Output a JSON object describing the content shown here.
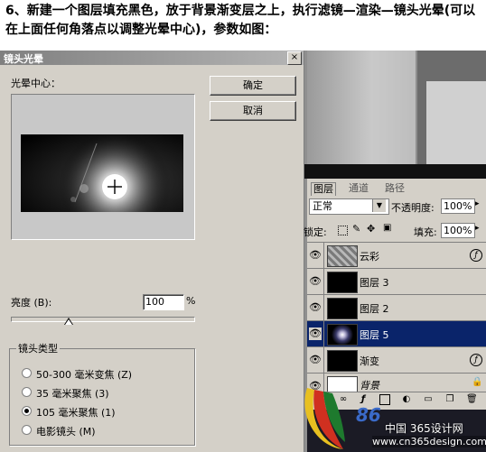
{
  "instructions": "6、新建一个图层填充黑色，放于背景渐变层之上，执行滤镜—渲染—镜头光晕(可以在上面任何角落点以调整光晕中心)，参数如图：",
  "dialog": {
    "title": "镜头光晕",
    "close": "×",
    "center_label": "光晕中心：",
    "ok": "确定",
    "cancel": "取消",
    "brightness_label": "亮度 (B):",
    "brightness_value": "100",
    "percent": "%",
    "brightness_level": 100,
    "lens_group_title": "镜头类型",
    "lens_types": [
      {
        "label": "50-300 毫米变焦 (Z)",
        "selected": false
      },
      {
        "label": "35 毫米聚焦 (3)",
        "selected": false
      },
      {
        "label": "105 毫米聚焦 (1)",
        "selected": true
      },
      {
        "label": "电影镜头 (M)",
        "selected": false
      }
    ]
  },
  "layers_panel": {
    "tabs": [
      "图层",
      "通道",
      "路径"
    ],
    "blend_mode": "正常",
    "opacity_label": "不透明度:",
    "opacity_value": "100%",
    "lock_label": "锁定:",
    "fill_label": "填充:",
    "fill_value": "100%",
    "layers": [
      {
        "name": "云彩",
        "selected": false
      },
      {
        "name": "图层 3",
        "selected": false
      },
      {
        "name": "图层 2",
        "selected": false
      },
      {
        "name": "图层 5",
        "selected": true
      },
      {
        "name": "渐变",
        "selected": false
      },
      {
        "name": "背景",
        "selected": false
      }
    ]
  },
  "watermark": {
    "site": "中国 365设计网",
    "url": "www.cn365design.com",
    "logo_text": "86"
  },
  "colors": {
    "dialog_bg": "#d4d0c8",
    "selection": "#0a246a"
  }
}
